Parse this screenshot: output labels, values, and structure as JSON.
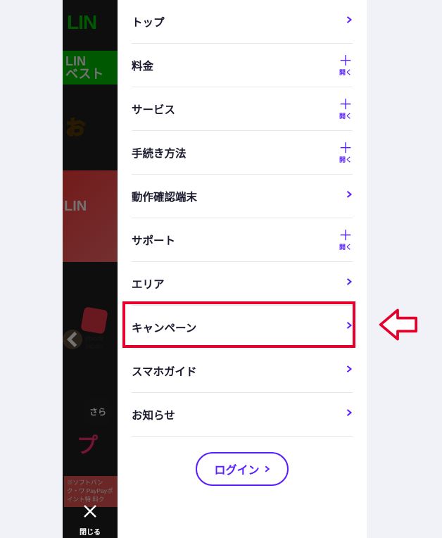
{
  "menu": {
    "items": [
      {
        "label": "トップ",
        "type": "link",
        "dn": "menu-item-top"
      },
      {
        "label": "料金",
        "type": "expand",
        "dn": "menu-item-price"
      },
      {
        "label": "サービス",
        "type": "expand",
        "dn": "menu-item-service"
      },
      {
        "label": "手続き方法",
        "type": "expand",
        "dn": "menu-item-procedure"
      },
      {
        "label": "動作確認端末",
        "type": "link",
        "dn": "menu-item-devices"
      },
      {
        "label": "サポート",
        "type": "expand",
        "dn": "menu-item-support"
      },
      {
        "label": "エリア",
        "type": "link",
        "dn": "menu-item-area"
      },
      {
        "label": "キャンペーン",
        "type": "link",
        "dn": "menu-item-campaign"
      },
      {
        "label": "スマホガイド",
        "type": "link",
        "dn": "menu-item-guide"
      },
      {
        "label": "お知らせ",
        "type": "link",
        "dn": "menu-item-news"
      }
    ],
    "expand_caption": "開く",
    "login_label": "ログイン"
  },
  "close": {
    "label": "閉じる"
  },
  "background": {
    "brand": "LIN",
    "green_band_line1": "LIN",
    "green_band_line2": "ベスト",
    "yellow_text": "お",
    "carousel_text": "LIN",
    "ebook_label": "ebook japan",
    "ebook_prefix": "ebo",
    "circle_label": "さら",
    "pink_text": "プ",
    "fineprint": "※ソフトバンク・ワ\nPayPayポイント特\n料ク"
  }
}
